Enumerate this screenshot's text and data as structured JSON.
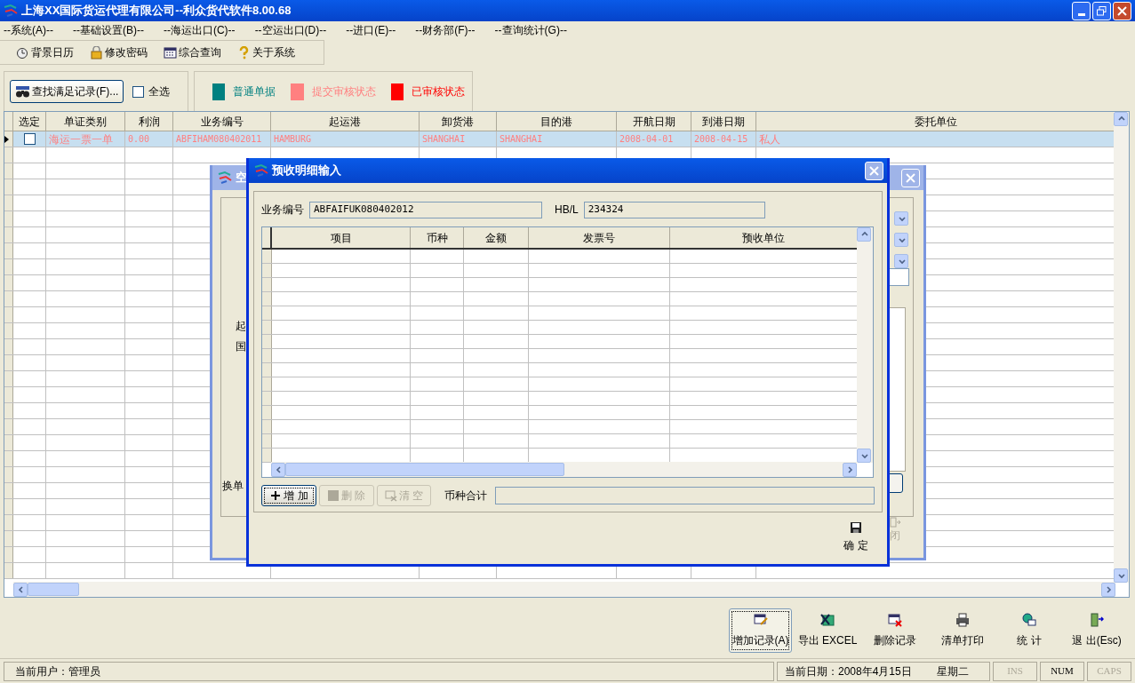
{
  "window": {
    "title": "上海XX国际货运代理有限公司--利众货代软件8.00.68"
  },
  "menu": [
    "--系统(A)--",
    "--基础设置(B)--",
    "--海运出口(C)--",
    "--空运出口(D)--",
    "--进口(E)--",
    "--财务部(F)--",
    "--查询统计(G)--"
  ],
  "toolbar": [
    "背景日历",
    "修改密码",
    "综合查询",
    "关于系统"
  ],
  "filter": {
    "find_button": "查找满足记录(F)...",
    "select_all": {
      "label": "全选",
      "checked": false
    }
  },
  "legend": [
    {
      "label": "普通单据",
      "color": "#008080"
    },
    {
      "label": "提交审核状态",
      "color": "#ff8080"
    },
    {
      "label": "已审核状态",
      "color": "#ff0000"
    }
  ],
  "grid": {
    "columns": [
      "选定",
      "单证类别",
      "利润",
      "业务编号",
      "起运港",
      "卸货港",
      "目的港",
      "开航日期",
      "到港日期",
      "委托单位"
    ],
    "rows": [
      {
        "selected": true,
        "checked": false,
        "color": "#ff8080",
        "cells": [
          "",
          "海运一票一单",
          "0.00",
          "ABFIHAM080402011",
          "HAMBURG",
          "SHANGHAI",
          "SHANGHAI",
          "2008-04-01",
          "2008-04-15",
          "私人"
        ]
      }
    ]
  },
  "back_dialog": {
    "title": "空",
    "labels": [
      "起",
      "国",
      "换单"
    ],
    "close_label": "闭"
  },
  "dialog": {
    "title": "预收明细输入",
    "fields": [
      {
        "label": "业务编号",
        "value": "ABFAIFUK080402012"
      },
      {
        "label": "HB/L",
        "value": "234324"
      }
    ],
    "columns": [
      "项目",
      "币种",
      "金额",
      "发票号",
      "预收单位"
    ],
    "buttons": [
      {
        "label": "增 加",
        "disabled": false
      },
      {
        "label": "删 除",
        "disabled": true
      },
      {
        "label": "清 空",
        "disabled": true
      }
    ],
    "total_label": "币种合计",
    "confirm": "确 定"
  },
  "actions": [
    {
      "label": "增加记录(A)",
      "focused": true
    },
    {
      "label": "导出 EXCEL",
      "focused": false
    },
    {
      "label": "删除记录",
      "focused": false
    },
    {
      "label": "清单打印",
      "focused": false
    },
    {
      "label": "统 计",
      "focused": false
    },
    {
      "label": "退 出(Esc)",
      "focused": false
    }
  ],
  "status_bar": {
    "user": "当前用户：管理员",
    "date": "当前日期：2008年4月15日",
    "weekday": "星期二",
    "indicators": [
      {
        "label": "INS",
        "on": false
      },
      {
        "label": "NUM",
        "on": true
      },
      {
        "label": "CAPS",
        "on": false
      }
    ]
  }
}
